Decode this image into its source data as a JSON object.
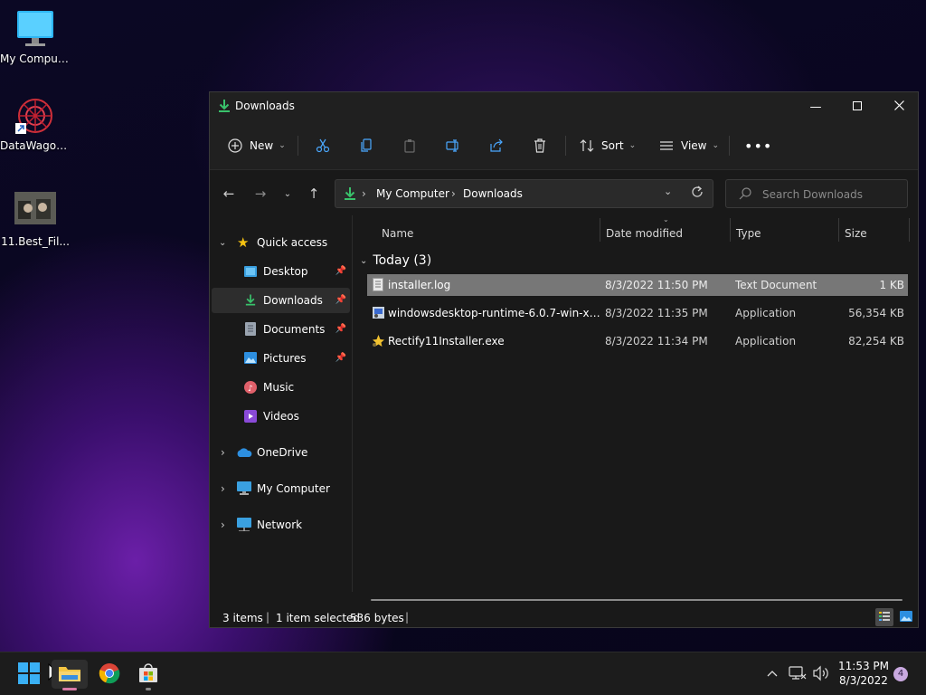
{
  "desktop": {
    "icons": [
      {
        "label": "My Computer"
      },
      {
        "label": "DataWagon..."
      },
      {
        "label": "11.Best_Fil..."
      }
    ]
  },
  "window": {
    "title": "Downloads",
    "toolbar": {
      "new_label": "New",
      "sort_label": "Sort",
      "view_label": "View"
    },
    "breadcrumb": [
      "My Computer",
      "Downloads"
    ],
    "search_placeholder": "Search Downloads",
    "sidebar": {
      "quick_access": "Quick access",
      "items": [
        {
          "label": "Desktop",
          "pinned": true
        },
        {
          "label": "Downloads",
          "pinned": true,
          "selected": true
        },
        {
          "label": "Documents",
          "pinned": true
        },
        {
          "label": "Pictures",
          "pinned": true
        },
        {
          "label": "Music",
          "pinned": false
        },
        {
          "label": "Videos",
          "pinned": false
        }
      ],
      "roots": [
        {
          "label": "OneDrive"
        },
        {
          "label": "My Computer"
        },
        {
          "label": "Network"
        }
      ]
    },
    "columns": [
      "Name",
      "Date modified",
      "Type",
      "Size"
    ],
    "group_label": "Today (3)",
    "files": [
      {
        "name": "installer.log",
        "date": "8/3/2022 11:50 PM",
        "type": "Text Document",
        "size": "1 KB",
        "selected": true
      },
      {
        "name": "windowsdesktop-runtime-6.0.7-win-x64....",
        "date": "8/3/2022 11:35 PM",
        "type": "Application",
        "size": "56,354 KB",
        "selected": false
      },
      {
        "name": "Rectify11Installer.exe",
        "date": "8/3/2022 11:34 PM",
        "type": "Application",
        "size": "82,254 KB",
        "selected": false
      }
    ],
    "status": {
      "items": "3 items",
      "selected": "1 item selected",
      "size": "536 bytes"
    }
  },
  "taskbar": {
    "time": "11:53 PM",
    "date": "8/3/2022",
    "notification_count": "4"
  },
  "colors": {
    "accent": "#35c2ff",
    "download_green": "#39c26b",
    "selection": "#777777"
  }
}
